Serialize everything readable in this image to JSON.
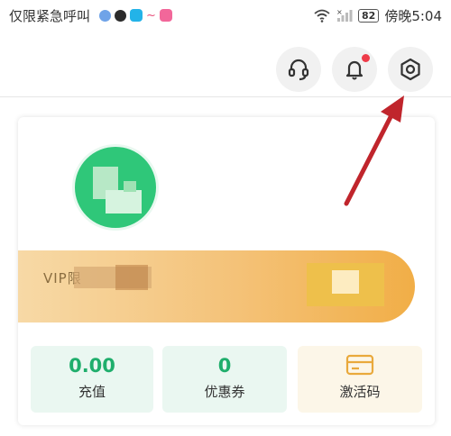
{
  "status_bar": {
    "carrier_text": "仅限紧急呼叫",
    "battery_level": "82",
    "time": "傍晚5:04",
    "notification_icons": [
      "globe-app-icon",
      "dark-circle-app-icon",
      "browser-app-icon",
      "signal-app-icon",
      "pink-app-icon"
    ]
  },
  "header": {
    "icons": [
      "headset-icon",
      "bell-icon",
      "settings-icon"
    ],
    "bell_has_badge": true,
    "accent_red": "#ee3b49"
  },
  "profile": {
    "avatar_color": "#2fc779",
    "vip_label": "VIP限"
  },
  "stats": [
    {
      "value": "0.00",
      "label": "充值"
    },
    {
      "value": "0",
      "label": "优惠券"
    },
    {
      "icon": "card-icon",
      "label": "激活码"
    }
  ],
  "colors": {
    "accent_green": "#1fae6c",
    "vip_gold": "#f1ae47",
    "arrow_red": "#c0252c"
  }
}
